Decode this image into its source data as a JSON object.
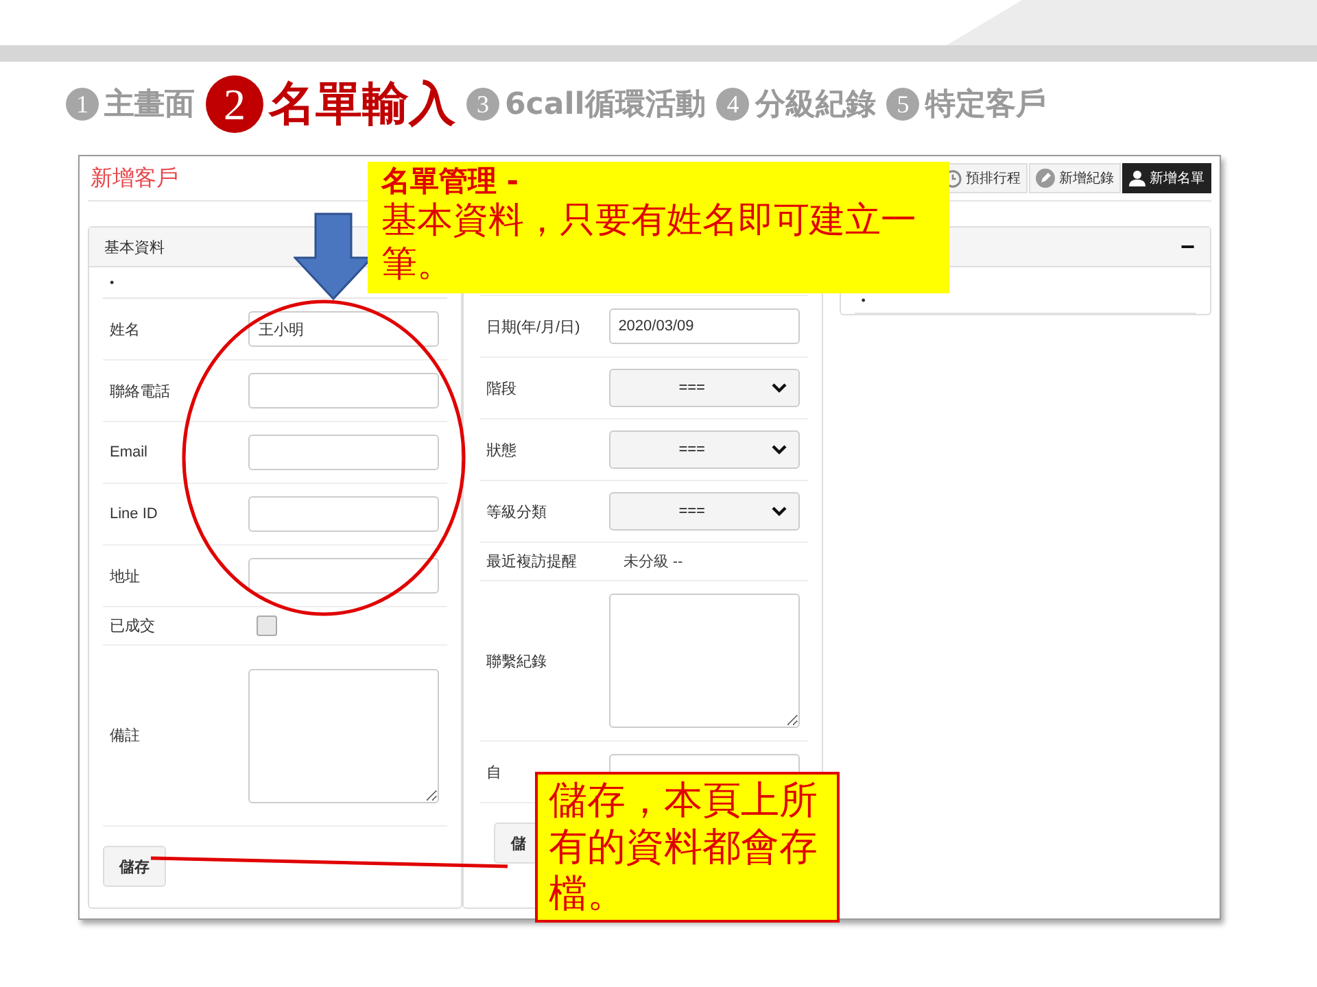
{
  "steps": [
    {
      "number": "1",
      "label": "主畫面",
      "selected": false
    },
    {
      "number": "2",
      "label": "名單輸入",
      "selected": true
    },
    {
      "number": "3",
      "label": "6call循環活動",
      "selected": false
    },
    {
      "number": "4",
      "label": "分級紀錄",
      "selected": false
    },
    {
      "number": "5",
      "label": "特定客戶",
      "selected": false
    }
  ],
  "page": {
    "title": "新增客戶",
    "toolbar": [
      {
        "label": "預排行程",
        "selected": false
      },
      {
        "label": "新增紀錄",
        "selected": false
      },
      {
        "label": "新增名單",
        "selected": true
      }
    ]
  },
  "basic_panel": {
    "title": "基本資料",
    "bullet": "•",
    "fields": [
      {
        "kind": "input",
        "label": "姓名",
        "value": "王小明"
      },
      {
        "kind": "input",
        "label": "聯絡電話"
      },
      {
        "kind": "input",
        "label": "Email"
      },
      {
        "kind": "input",
        "label": "Line ID"
      },
      {
        "kind": "input",
        "label": "地址"
      },
      {
        "kind": "checkbox",
        "label": "已成交",
        "checked": false
      },
      {
        "kind": "textarea",
        "label": "備註"
      }
    ],
    "save_button": "儲存"
  },
  "record_panel": {
    "fields": [
      {
        "kind": "input",
        "label": "日期(年/月/日)",
        "value": "2020/03/09"
      },
      {
        "kind": "select",
        "label": "階段",
        "value": "==="
      },
      {
        "kind": "select",
        "label": "狀態",
        "value": "==="
      },
      {
        "kind": "select",
        "label": "等級分類",
        "value": "==="
      },
      {
        "kind": "text",
        "label": "最近複訪提醒",
        "value": "未分級 --"
      },
      {
        "kind": "textarea",
        "label": "聯繫紀錄"
      },
      {
        "kind": "input",
        "label": "自"
      }
    ],
    "save_button": "儲"
  },
  "side_panel": {
    "collapse": "−",
    "bullet": "•"
  },
  "callouts": [
    {
      "title": "名單管理 -",
      "text": "基本資料，只要有姓名即可建立一筆。"
    },
    {
      "text": "儲存，本頁上所有的資料都會存檔。"
    }
  ]
}
